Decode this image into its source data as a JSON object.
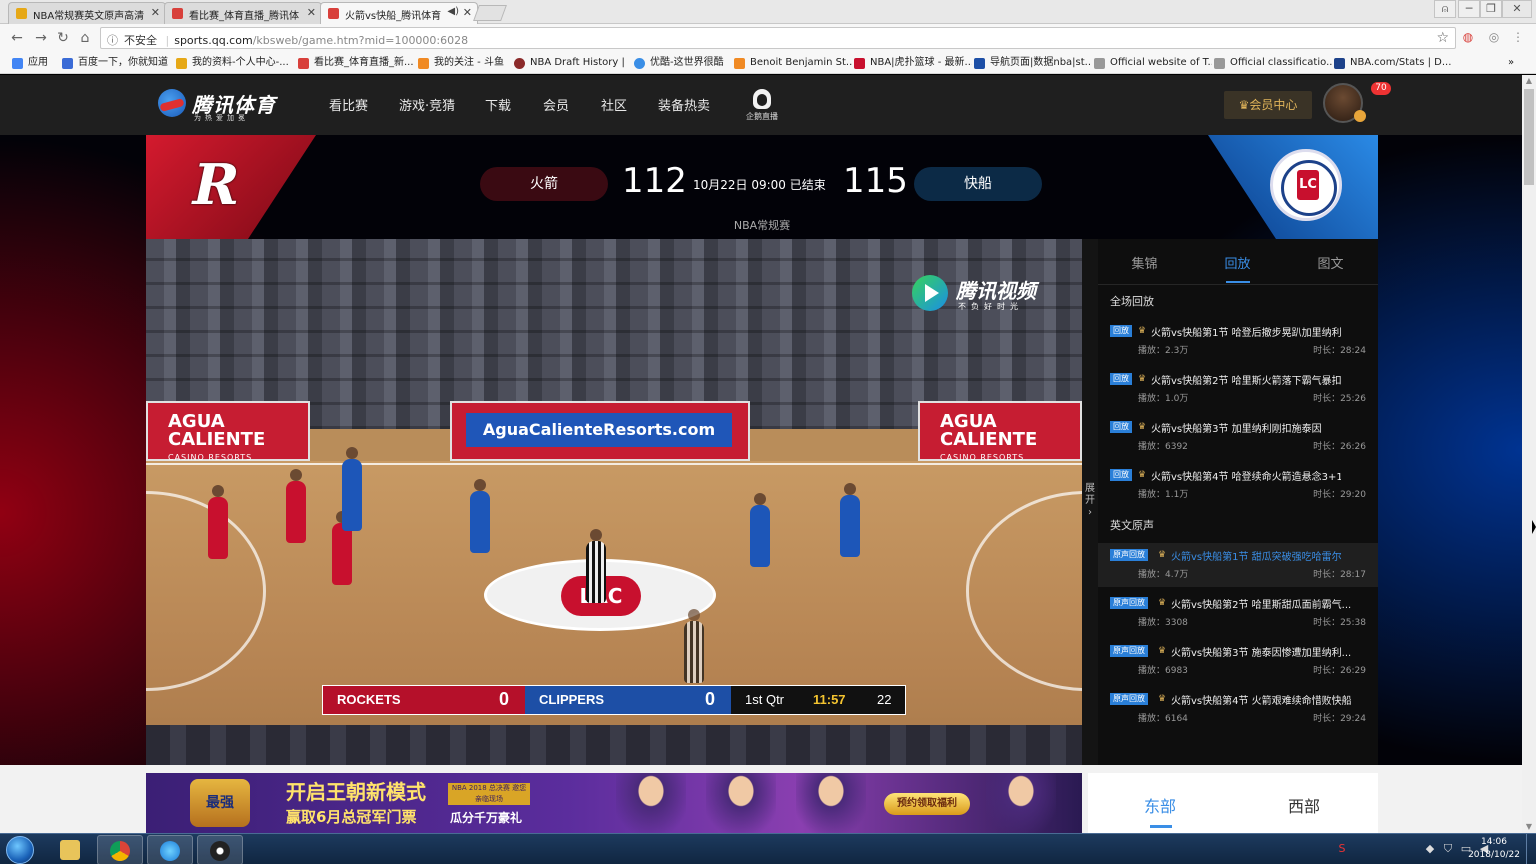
{
  "browser": {
    "tabs": [
      {
        "title": "NBA常规赛英文原声高清",
        "favicon_color": "#e6a817"
      },
      {
        "title": "看比赛_体育直播_腾讯体",
        "favicon_color": "#d8403b"
      },
      {
        "title": "火箭vs快船_腾讯体育",
        "favicon_color": "#d8403b"
      }
    ],
    "address": {
      "security": "不安全",
      "host": "sports.qq.com",
      "path": "/kbsweb/game.htm?mid=100000:6028"
    },
    "bookmarks": [
      {
        "label": "应用",
        "color": "#4285f4"
      },
      {
        "label": "百度一下，你就知道",
        "color": "#3a6bd6"
      },
      {
        "label": "我的资料-个人中心-...",
        "color": "#e6a817"
      },
      {
        "label": "看比赛_体育直播_新...",
        "color": "#d8403b"
      },
      {
        "label": "我的关注 - 斗鱼",
        "color": "#f08a24"
      },
      {
        "label": "NBA Draft History |",
        "color": "#8b2a2a"
      },
      {
        "label": "优酷-这世界很酷",
        "color": "#3a8ee6"
      },
      {
        "label": "Benoit Benjamin St...",
        "color": "#f08a24"
      },
      {
        "label": "NBA|虎扑篮球 - 最新...",
        "color": "#c8102e"
      },
      {
        "label": "导航页面|数据nba|st...",
        "color": "#1d4fa6"
      },
      {
        "label": "Official website of T...",
        "color": "#999999"
      },
      {
        "label": "Official classificatio...",
        "color": "#999999"
      },
      {
        "label": "NBA.com/Stats | D...",
        "color": "#1d428a"
      }
    ]
  },
  "site": {
    "logo": "腾讯体育",
    "logo_slogan": "为热爱加冕",
    "nav": [
      "看比赛",
      "游戏·竞猜",
      "下载",
      "会员",
      "社区",
      "装备热卖"
    ],
    "live_label": "企鹅直播",
    "member_center": "会员中心",
    "notif_count": "70"
  },
  "game": {
    "home_team": "火箭",
    "home_score": "112",
    "away_team": "快船",
    "away_score": "115",
    "status": "10月22日 09:00 已结束",
    "league": "NBA常规赛",
    "home_color": "#d41a2e",
    "away_color": "#1d4fa6"
  },
  "video": {
    "watermark_name": "腾讯视频",
    "watermark_slogan": "不负好时光",
    "ad_main": "AguaCalienteResorts.com",
    "ad_side": "AGUA CALIENTE",
    "ad_side_sub": "CASINO RESORTS",
    "court_logo": "LAC",
    "scorebug": {
      "home": "ROCKETS",
      "home_score": "0",
      "away": "CLIPPERS",
      "away_score": "0",
      "quarter": "1st Qtr",
      "clock": "11:57",
      "shot_clock": "22"
    },
    "expand_label": "展开 ›"
  },
  "panel": {
    "tabs": [
      "集锦",
      "回放",
      "图文"
    ],
    "active_tab": "回放",
    "sections": [
      {
        "title": "全场回放",
        "items": [
          {
            "tag": "回放",
            "title": "火箭vs快船第1节 哈登后撤步晃趴加里纳利",
            "views": "播放：2.3万",
            "duration": "时长：28:24"
          },
          {
            "tag": "回放",
            "title": "火箭vs快船第2节 哈里斯火箭落下霸气暴扣",
            "views": "播放：1.0万",
            "duration": "时长：25:26"
          },
          {
            "tag": "回放",
            "title": "火箭vs快船第3节 加里纳利刚扣施泰因",
            "views": "播放：6392",
            "duration": "时长：26:26"
          },
          {
            "tag": "回放",
            "title": "火箭vs快船第4节 哈登续命火箭造悬念3+1",
            "views": "播放：1.1万",
            "duration": "时长：29:20"
          }
        ]
      },
      {
        "title": "英文原声",
        "items": [
          {
            "tag": "原声回放",
            "title": "火箭vs快船第1节 甜瓜突破强吃哈雷尔",
            "views": "播放：4.7万",
            "duration": "时长：28:17"
          },
          {
            "tag": "原声回放",
            "title": "火箭vs快船第2节 哈里斯甜瓜面前霸气...",
            "views": "播放：3308",
            "duration": "时长：25:38"
          },
          {
            "tag": "原声回放",
            "title": "火箭vs快船第3节 施泰因惨遭加里纳利...",
            "views": "播放：6983",
            "duration": "时长：26:29"
          },
          {
            "tag": "原声回放",
            "title": "火箭vs快船第4节 火箭艰难续命惜败快船",
            "views": "播放：6164",
            "duration": "时长：29:24"
          }
        ]
      }
    ]
  },
  "promo": {
    "game_logo": "最强NBA",
    "headline": "开启王朝新模式",
    "headline2": "赢取6月总冠军门票",
    "sub": "瓜分千万豪礼",
    "badge": "NBA 2018 总决赛 邀您 亲临现场",
    "cta": "预约领取福利"
  },
  "conference": {
    "east": "东部",
    "west": "西部"
  },
  "taskbar": {
    "time": "14:06",
    "date": "2018/10/22"
  }
}
